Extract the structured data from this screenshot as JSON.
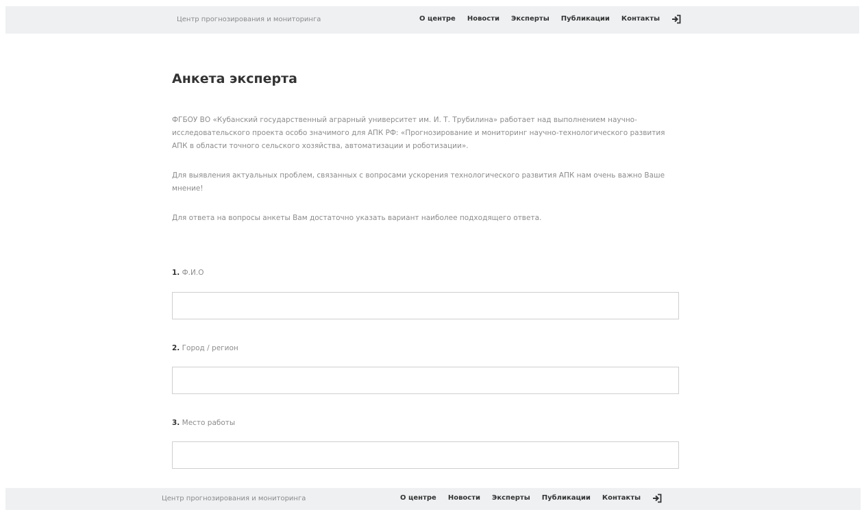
{
  "header": {
    "brand": "Центр прогнозирования и мониторинга",
    "nav": [
      "О центре",
      "Новости",
      "Эксперты",
      "Публикации",
      "Контакты"
    ],
    "login_icon": "sign-in-icon"
  },
  "main": {
    "title": "Анкета эксперта",
    "paragraphs": [
      "ФГБОУ ВО «Кубанский государственный аграрный университет им. И. Т. Трубилина» работает над выполнением научно-исследовательского проекта особо значимого для АПК РФ: «Прогнозирование и мониторинг научно-технологического развития АПК в области точного сельского хозяйства, автоматизации и роботизации».",
      "Для выявления актуальных проблем, связанных с вопросами ускорения технологического развития АПК нам очень важно Ваше мнение!",
      "Для ответа на вопросы анкеты Вам достаточно указать вариант наиболее подходящего ответа."
    ],
    "questions": [
      {
        "number": "1.",
        "label": "Ф.И.О",
        "value": ""
      },
      {
        "number": "2.",
        "label": "Город / регион",
        "value": ""
      },
      {
        "number": "3.",
        "label": "Место работы",
        "value": ""
      }
    ]
  },
  "footer": {
    "brand": "Центр прогнозирования и мониторинга",
    "nav": [
      "О центре",
      "Новости",
      "Эксперты",
      "Публикации",
      "Контакты"
    ],
    "login_icon": "sign-in-icon"
  }
}
